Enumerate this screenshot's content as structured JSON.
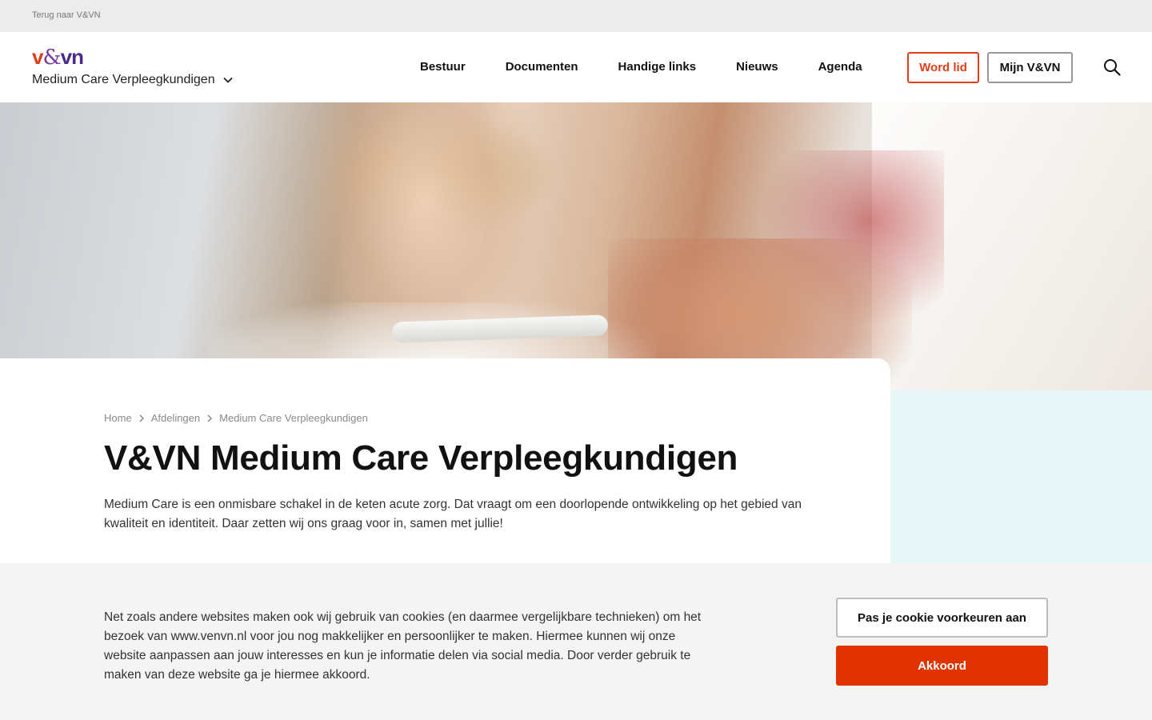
{
  "topbar": {
    "back_link": "Terug naar V&VN"
  },
  "header": {
    "logo": {
      "v": "v",
      "amp": "&",
      "n": "vn"
    },
    "department": "Medium Care Verpleegkundigen",
    "nav": [
      "Bestuur",
      "Documenten",
      "Handige links",
      "Nieuws",
      "Agenda"
    ],
    "word_lid": "Word lid",
    "mijn": "Mijn V&VN"
  },
  "breadcrumb": [
    "Home",
    "Afdelingen",
    "Medium Care Verpleegkundigen"
  ],
  "page": {
    "title": "V&VN Medium Care Verpleegkundigen",
    "intro": "Medium Care is een onmisbare schakel in de keten acute zorg. Dat vraagt om een doorlopende ontwikkeling op het gebied van kwaliteit en identiteit. Daar zetten wij ons graag voor in, samen met jullie!"
  },
  "cookie": {
    "text": "Net zoals andere websites maken ook wij gebruik van cookies (en daarmee vergelijkbare technieken) om het bezoek van www.venvn.nl voor jou nog makkelijker en persoonlijker te maken. Hiermee kunnen wij onze website aanpassen aan jouw interesses en kun je informatie delen via social media. Door verder gebruik te maken van deze website ga je hiermee akkoord.",
    "prefs_button": "Pas je cookie voorkeuren aan",
    "accept_button": "Akkoord"
  },
  "colors": {
    "accent": "#e03300",
    "brand_purple": "#4b2a8a",
    "aqua": "#e7f6f6"
  },
  "icons": [
    "chevron-down-icon",
    "search-icon",
    "chevron-right-icon"
  ]
}
